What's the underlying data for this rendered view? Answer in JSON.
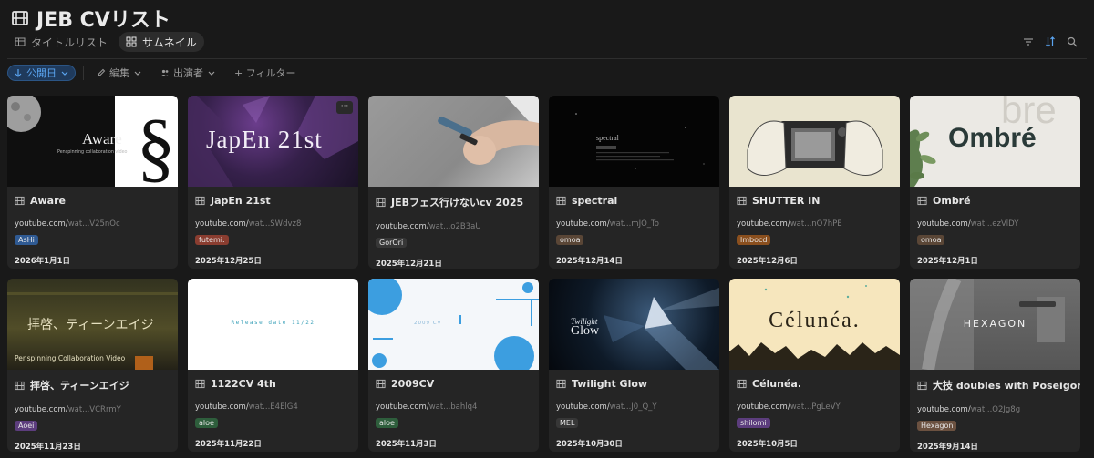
{
  "page": {
    "title": "JEB CVリスト"
  },
  "views": [
    {
      "label": "タイトルリスト",
      "icon": "table-icon",
      "active": false
    },
    {
      "label": "サムネイル",
      "icon": "grid-icon",
      "active": true
    }
  ],
  "filters": {
    "sort_label": "公開日",
    "edit_label": "編集",
    "cast_label": "出演者",
    "add_filter_label": "+ フィルター"
  },
  "cards": [
    {
      "title": "Aware",
      "url_host": "youtube.com/",
      "url_rest": "wat...V25nOc",
      "tag": "AsHi",
      "tag_color": "#2f5a93",
      "date": "2026年1月1日",
      "thumb_text": "Aware",
      "thumb_sub": "Penspinning collaboration video"
    },
    {
      "title": "JapEn 21st",
      "url_host": "youtube.com/",
      "url_rest": "wat...SWdvz8",
      "tag": "futemi.",
      "tag_color": "#8a3d30",
      "date": "2025年12月25日",
      "thumb_text": "JapEn 21st"
    },
    {
      "title": "JEBフェス行けないcv 2025",
      "url_host": "youtube.com/",
      "url_rest": "wat...o2B3aU",
      "tag": "GorOri",
      "tag_color": "#373737",
      "date": "2025年12月21日"
    },
    {
      "title": "spectral",
      "url_host": "youtube.com/",
      "url_rest": "wat...mJO_To",
      "tag": "omoa",
      "tag_color": "#5a4636",
      "date": "2025年12月14日",
      "thumb_text": "spectral"
    },
    {
      "title": "SHUTTER IN",
      "url_host": "youtube.com/",
      "url_rest": "wat...nO7hPE",
      "tag": "lmbocd",
      "tag_color": "#8a4f1e",
      "date": "2025年12月6日"
    },
    {
      "title": "Ombré",
      "url_host": "youtube.com/",
      "url_rest": "wat...ezVlDY",
      "tag": "omoa",
      "tag_color": "#5a4636",
      "date": "2025年12月1日",
      "thumb_text": "Ombré",
      "thumb_bg_text": "bre"
    },
    {
      "title": "拝啓、ティーンエイジ",
      "url_host": "youtube.com/",
      "url_rest": "wat...VCRrmY",
      "tag": "Aoei",
      "tag_color": "#5c3d7d",
      "date": "2025年11月23日",
      "thumb_text": "拝啓、ティーンエイジ",
      "thumb_sub": "Penspinning Collaboration Video"
    },
    {
      "title": "1122CV 4th",
      "url_host": "youtube.com/",
      "url_rest": "wat...E4ElG4",
      "tag": "aloe",
      "tag_color": "#2e5e3c",
      "date": "2025年11月22日",
      "thumb_text": "Release date 11/22"
    },
    {
      "title": "2009CV",
      "url_host": "youtube.com/",
      "url_rest": "wat...bahlq4",
      "tag": "aloe",
      "tag_color": "#2e5e3c",
      "date": "2025年11月3日",
      "thumb_text": "2009 CV"
    },
    {
      "title": "Twilight Glow",
      "url_host": "youtube.com/",
      "url_rest": "wat...J0_Q_Y",
      "tag": "MEL",
      "tag_color": "#373737",
      "date": "2025年10月30日",
      "thumb_text": "Glow",
      "thumb_sub": "Twilight"
    },
    {
      "title": "Célunéa.",
      "url_host": "youtube.com/",
      "url_rest": "wat...PgLeVY",
      "tag": "shilomi",
      "tag_color": "#5c3d7d",
      "date": "2025年10月5日",
      "thumb_text": "Célunéa."
    },
    {
      "title": "大技 doubles with Poseigon",
      "url_host": "youtube.com/",
      "url_rest": "wat...Q2Jg8g",
      "tag": "Hexagon",
      "tag_color": "#6b5140",
      "date": "2025年9月14日",
      "thumb_text": "HEXAGON"
    }
  ]
}
